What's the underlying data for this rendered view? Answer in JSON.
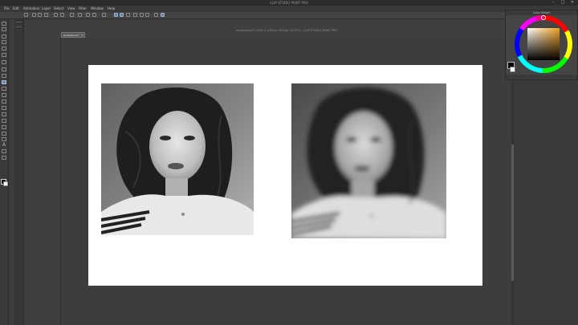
{
  "window": {
    "app_title": "CLIP STUDIO PAINT PRO",
    "document_title": "Illustration2* (1920 x 1080px 350dpi 100.0%) - CLIP STUDIO PAINT PRO",
    "document_tab": "Illustration2*"
  },
  "menu": {
    "items": [
      "File",
      "Edit",
      "Animation",
      "Layer",
      "Select",
      "View",
      "Filter",
      "Window",
      "Help"
    ]
  },
  "color_panel": {
    "title": "Color Wheel",
    "foreground": "#000000",
    "background": "#ffffff",
    "selected_hue": "#f0a020"
  },
  "canvas": {
    "paper_color": "#ffffff",
    "workspace_color": "#3f3f3f",
    "accent_color": "#6b7f9e"
  },
  "icons": {
    "close": "✕",
    "minimize": "–",
    "maximize": "□",
    "text_tool": "A"
  }
}
